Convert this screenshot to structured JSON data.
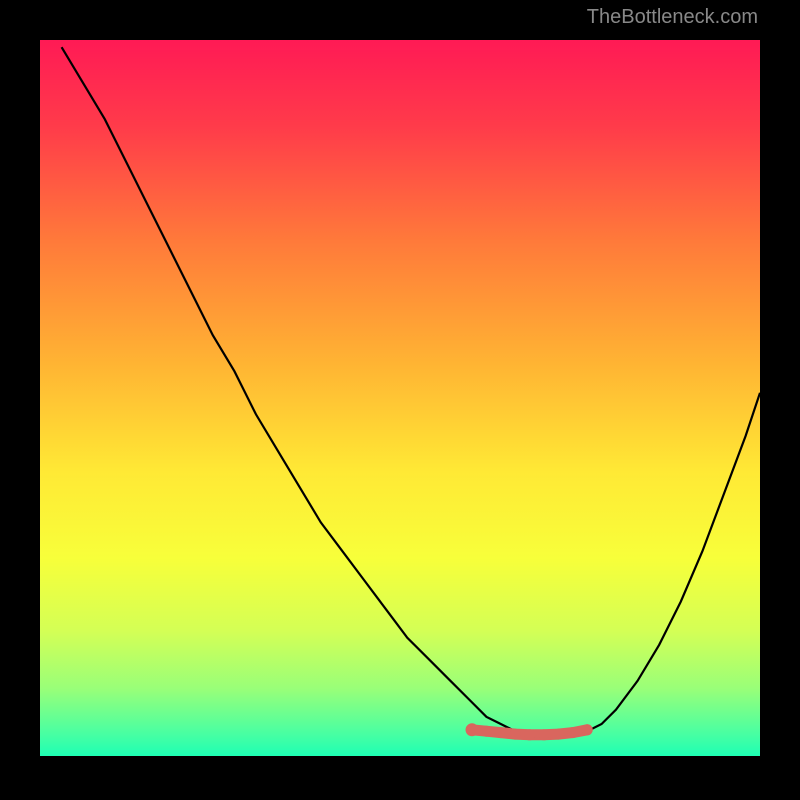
{
  "watermark": "TheBottleneck.com",
  "colors": {
    "curve": "#000000",
    "dots": "#d9665e",
    "bg_black": "#000000"
  },
  "chart_data": {
    "type": "line",
    "title": "",
    "xlabel": "",
    "ylabel": "",
    "xlim": [
      0,
      100
    ],
    "ylim": [
      0,
      100
    ],
    "series": [
      {
        "name": "bottleneck-curve",
        "x": [
          3,
          6,
          9,
          12,
          15,
          18,
          21,
          24,
          27,
          30,
          33,
          36,
          39,
          42,
          45,
          48,
          51,
          54,
          57,
          60,
          62,
          64,
          66,
          68,
          70,
          72,
          74,
          76,
          78,
          80,
          83,
          86,
          89,
          92,
          95,
          98,
          100
        ],
        "y": [
          99,
          94,
          89,
          83,
          77,
          71,
          65,
          59,
          54,
          48,
          43,
          38,
          33,
          29,
          25,
          21,
          17,
          14,
          11,
          8,
          6,
          5,
          4,
          3.5,
          3.2,
          3.2,
          3.4,
          4,
          5,
          7,
          11,
          16,
          22,
          29,
          37,
          45,
          51
        ]
      },
      {
        "name": "optimal-range-dots",
        "x": [
          60,
          62,
          64,
          66,
          68,
          70,
          72,
          74,
          76
        ],
        "y": [
          4.2,
          4.0,
          3.8,
          3.6,
          3.5,
          3.5,
          3.6,
          3.8,
          4.2
        ]
      }
    ],
    "gradient_stops": [
      {
        "offset": 0.0,
        "color": "#ff1a55"
      },
      {
        "offset": 0.12,
        "color": "#ff3b4a"
      },
      {
        "offset": 0.28,
        "color": "#ff7a3a"
      },
      {
        "offset": 0.45,
        "color": "#ffb433"
      },
      {
        "offset": 0.6,
        "color": "#ffe935"
      },
      {
        "offset": 0.72,
        "color": "#f7ff3a"
      },
      {
        "offset": 0.82,
        "color": "#d4ff55"
      },
      {
        "offset": 0.9,
        "color": "#9aff78"
      },
      {
        "offset": 0.96,
        "color": "#4dffa0"
      },
      {
        "offset": 1.0,
        "color": "#17ffb7"
      }
    ]
  }
}
